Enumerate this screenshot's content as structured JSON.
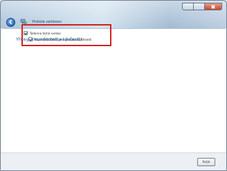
{
  "window": {
    "title": "Yhdistä verkkoon",
    "caption_buttons": [
      "minimize-icon",
      "maximize-icon",
      "close-icon"
    ]
  },
  "content": {
    "heading": "Yhteys muodostettu (default)",
    "options": [
      {
        "label": "Tallenna tämä verkko",
        "checked": true
      },
      {
        "label": "Käynnistä tämä yhteys automaattisesti",
        "checked": true
      }
    ]
  },
  "footer": {
    "close_label": "Sulje"
  },
  "colors": {
    "heading": "#1f5aa6",
    "highlight_border": "#d22020"
  }
}
